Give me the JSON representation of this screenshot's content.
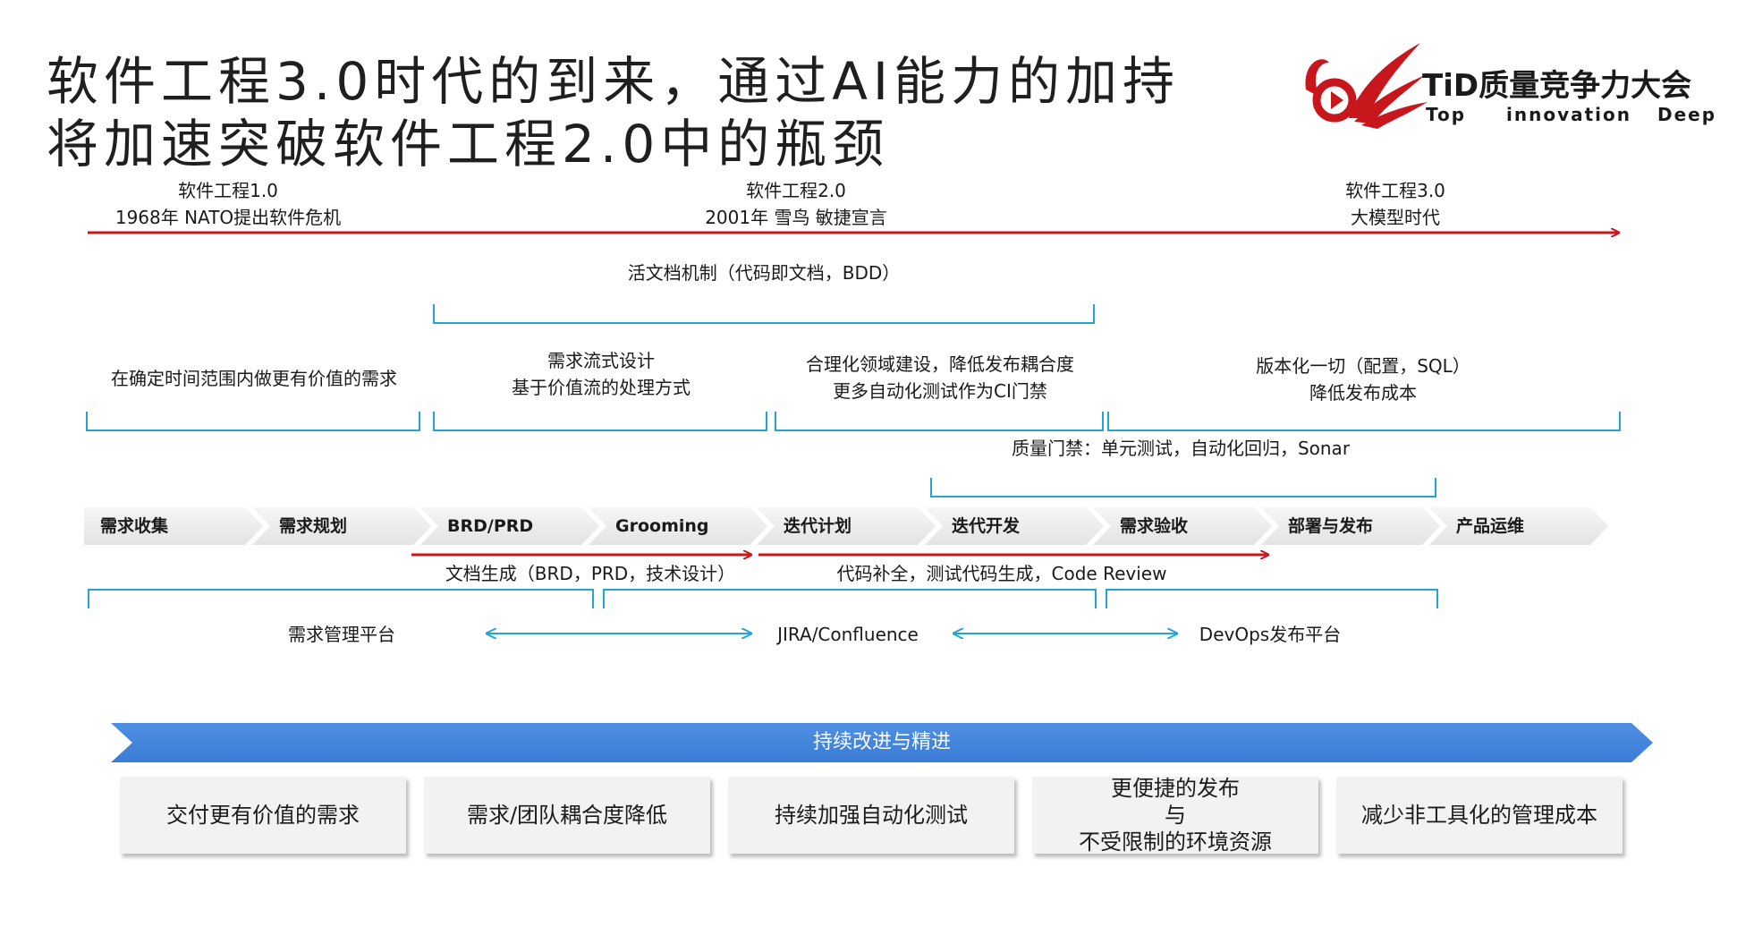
{
  "title": {
    "line1": "软件工程3.0时代的到来，通过AI能力的加持",
    "line2": "将加速突破软件工程2.0中的瓶颈"
  },
  "logo": {
    "name": "TiD质量竞争力大会",
    "words": [
      "Top",
      "innovation",
      "Deep"
    ],
    "colors": {
      "red": "#c8161d"
    }
  },
  "timeline": {
    "eras": [
      {
        "name": "软件工程1.0",
        "detail": "1968年 NATO提出软件危机"
      },
      {
        "name": "软件工程2.0",
        "detail": "2001年 雪鸟 敏捷宣言"
      },
      {
        "name": "软件工程3.0",
        "detail": "大模型时代"
      }
    ]
  },
  "annotations": {
    "living_docs": "活文档机制（代码即文档，BDD）",
    "valuable_req": "在确定时间范围内做更有价值的需求",
    "flow_design": [
      "需求流式设计",
      "基于价值流的处理方式"
    ],
    "domain": [
      "合理化领域建设，降低发布耦合度",
      "更多自动化测试作为CI门禁"
    ],
    "versioning": [
      "版本化一切（配置，SQL）",
      "降低发布成本"
    ],
    "quality_gate": "质量门禁：单元测试，自动化回归，Sonar",
    "doc_gen": "文档生成（BRD，PRD，技术设计）",
    "code_gen": "代码补全，测试代码生成，Code Review"
  },
  "process_steps": [
    "需求收集",
    "需求规划",
    "BRD/PRD",
    "Grooming",
    "迭代计划",
    "迭代开发",
    "需求验收",
    "部署与发布",
    "产品运维"
  ],
  "platforms": [
    "需求管理平台",
    "JIRA/Confluence",
    "DevOps发布平台"
  ],
  "improvement_bar": "持续改进与精进",
  "outcomes": [
    "交付更有价值的需求",
    "需求/团队耦合度降低",
    "持续加强自动化测试",
    [
      "更便捷的发布",
      "与",
      "不受限制的环境资源"
    ],
    "减少非工具化的管理成本"
  ],
  "colors": {
    "timeline_red": "#c8161d",
    "bracket_blue": "#24a3d6",
    "bar_blue": "#4a8ae0"
  }
}
